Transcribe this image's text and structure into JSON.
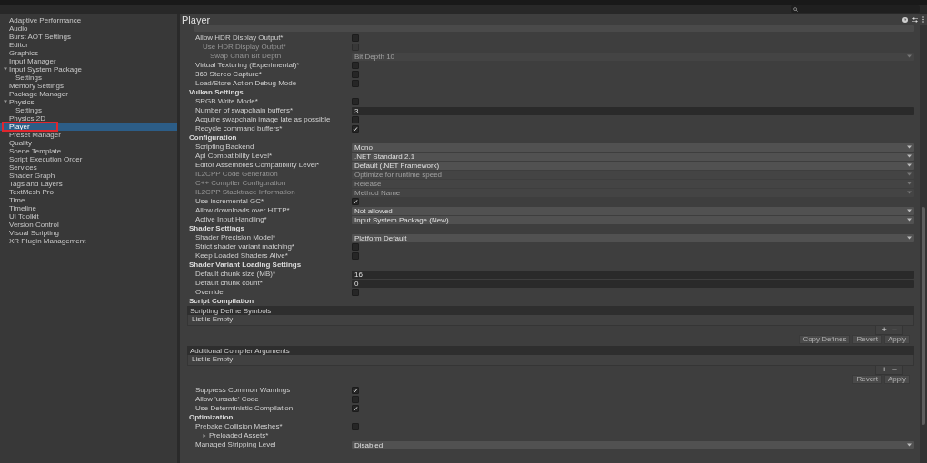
{
  "sidebar": {
    "items": [
      {
        "label": "Adaptive Performance",
        "selected": false
      },
      {
        "label": "Audio",
        "selected": false
      },
      {
        "label": "Burst AOT Settings",
        "selected": false
      },
      {
        "label": "Editor",
        "selected": false
      },
      {
        "label": "Graphics",
        "selected": false
      },
      {
        "label": "Input Manager",
        "selected": false
      },
      {
        "label": "Input System Package",
        "selected": false,
        "expanded": true,
        "children": [
          {
            "label": "Settings",
            "selected": false
          }
        ]
      },
      {
        "label": "Memory Settings",
        "selected": false
      },
      {
        "label": "Package Manager",
        "selected": false
      },
      {
        "label": "Physics",
        "selected": false,
        "expanded": true,
        "children": [
          {
            "label": "Settings",
            "selected": false
          }
        ]
      },
      {
        "label": "Physics 2D",
        "selected": false
      },
      {
        "label": "Player",
        "selected": true
      },
      {
        "label": "Preset Manager",
        "selected": false
      },
      {
        "label": "Quality",
        "selected": false
      },
      {
        "label": "Scene Template",
        "selected": false
      },
      {
        "label": "Script Execution Order",
        "selected": false
      },
      {
        "label": "Services",
        "selected": false
      },
      {
        "label": "Shader Graph",
        "selected": false
      },
      {
        "label": "Tags and Layers",
        "selected": false
      },
      {
        "label": "TextMesh Pro",
        "selected": false
      },
      {
        "label": "Time",
        "selected": false
      },
      {
        "label": "Timeline",
        "selected": false
      },
      {
        "label": "UI Toolkit",
        "selected": false
      },
      {
        "label": "Version Control",
        "selected": false
      },
      {
        "label": "Visual Scripting",
        "selected": false
      },
      {
        "label": "XR Plugin Management",
        "selected": false
      }
    ]
  },
  "panel": {
    "title": "Player"
  },
  "rows": [
    {
      "kind": "checkbox",
      "label": "Allow HDR Display Output*",
      "checked": false,
      "disabled": false,
      "children": [
        {
          "kind": "checkbox",
          "label": "Use HDR Display Output*",
          "checked": false,
          "disabled": true,
          "children": [
            {
              "kind": "dropdown",
              "label": "Swap Chain Bit Depth",
              "value": "Bit Depth 10",
              "disabled": true
            }
          ]
        }
      ]
    },
    {
      "kind": "checkbox",
      "label": "Virtual Texturing (Experimental)*",
      "checked": false,
      "disabled": false
    },
    {
      "kind": "checkbox",
      "label": "360 Stereo Capture*",
      "checked": false,
      "disabled": false
    },
    {
      "kind": "checkbox",
      "label": "Load/Store Action Debug Mode",
      "checked": false,
      "disabled": false
    },
    {
      "kind": "header",
      "label": "Vulkan Settings"
    },
    {
      "kind": "checkbox",
      "label": "SRGB Write Mode*",
      "checked": false,
      "disabled": false
    },
    {
      "kind": "textfield",
      "label": "Number of swapchain buffers*",
      "value": "3",
      "disabled": false
    },
    {
      "kind": "checkbox",
      "label": "Acquire swapchain image late as possible",
      "checked": false,
      "disabled": false
    },
    {
      "kind": "checkbox",
      "label": "Recycle command buffers*",
      "checked": true,
      "disabled": false
    },
    {
      "kind": "header",
      "label": "Configuration"
    },
    {
      "kind": "dropdown",
      "label": "Scripting Backend",
      "value": "Mono",
      "disabled": false
    },
    {
      "kind": "dropdown",
      "label": "Api Compatibility Level*",
      "value": ".NET Standard 2.1",
      "disabled": false
    },
    {
      "kind": "dropdown",
      "label": "Editor Assemblies Compatibility Level*",
      "value": "Default (.NET Framework)",
      "disabled": false
    },
    {
      "kind": "dropdown",
      "label": "IL2CPP Code Generation",
      "value": "Optimize for runtime speed",
      "disabled": true
    },
    {
      "kind": "dropdown",
      "label": "C++ Compiler Configuration",
      "value": "Release",
      "disabled": true
    },
    {
      "kind": "dropdown",
      "label": "IL2CPP Stacktrace Information",
      "value": "Method Name",
      "disabled": true
    },
    {
      "kind": "checkbox",
      "label": "Use incremental GC*",
      "checked": true,
      "disabled": false
    },
    {
      "kind": "dropdown",
      "label": "Allow downloads over HTTP*",
      "value": "Not allowed",
      "disabled": false
    },
    {
      "kind": "dropdown",
      "label": "Active Input Handling*",
      "value": "Input System Package (New)",
      "disabled": false
    },
    {
      "kind": "header",
      "label": "Shader Settings"
    },
    {
      "kind": "dropdown",
      "label": "Shader Precision Model*",
      "value": "Platform Default",
      "disabled": false
    },
    {
      "kind": "checkbox",
      "label": "Strict shader variant matching*",
      "checked": false,
      "disabled": false
    },
    {
      "kind": "checkbox",
      "label": "Keep Loaded Shaders Alive*",
      "checked": false,
      "disabled": false
    },
    {
      "kind": "header",
      "label": "Shader Variant Loading Settings"
    },
    {
      "kind": "textfield",
      "label": "Default chunk size (MB)*",
      "value": "16",
      "disabled": false
    },
    {
      "kind": "textfield",
      "label": "Default chunk count*",
      "value": "0",
      "disabled": false
    },
    {
      "kind": "checkbox",
      "label": "Override",
      "checked": false,
      "disabled": false
    },
    {
      "kind": "header",
      "label": "Script Compilation"
    },
    {
      "kind": "list",
      "label": "Scripting Define Symbols",
      "empty_text": "List is Empty",
      "add": "+",
      "remove": "−",
      "buttons": [
        "Copy Defines",
        "Revert",
        "Apply"
      ]
    },
    {
      "kind": "list",
      "label": "Additional Compiler Arguments",
      "empty_text": "List is Empty",
      "add": "+",
      "remove": "−",
      "buttons": [
        "Revert",
        "Apply"
      ]
    },
    {
      "kind": "checkbox",
      "label": "Suppress Common Warnings",
      "checked": true,
      "disabled": false
    },
    {
      "kind": "checkbox",
      "label": "Allow 'unsafe' Code",
      "checked": false,
      "disabled": false
    },
    {
      "kind": "checkbox",
      "label": "Use Deterministic Compilation",
      "checked": true,
      "disabled": false
    },
    {
      "kind": "header",
      "label": "Optimization"
    },
    {
      "kind": "checkbox",
      "label": "Prebake Collision Meshes*",
      "checked": false,
      "disabled": false
    },
    {
      "kind": "foldout",
      "label": "Preloaded Assets*",
      "expanded": false
    },
    {
      "kind": "dropdown",
      "label": "Managed Stripping Level",
      "value": "Disabled",
      "disabled": false
    }
  ]
}
